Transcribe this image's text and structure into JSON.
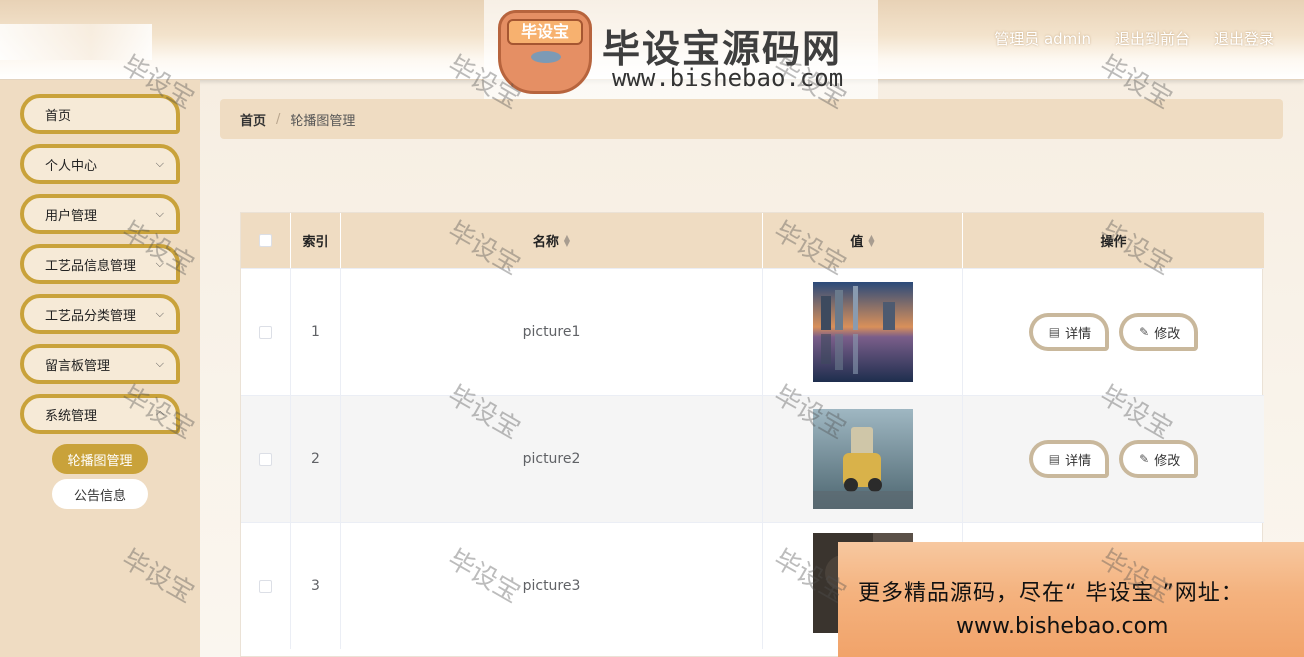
{
  "header": {
    "user_label": "管理员 admin",
    "to_front_label": "退出到前台",
    "logout_label": "退出登录"
  },
  "brand": {
    "logo_text": "毕设宝",
    "title": "毕设宝源码网",
    "url": "www.bishebao.com"
  },
  "sidebar": {
    "items": [
      {
        "label": "首页",
        "has_children": false
      },
      {
        "label": "个人中心",
        "has_children": true
      },
      {
        "label": "用户管理",
        "has_children": true
      },
      {
        "label": "工艺品信息管理",
        "has_children": true
      },
      {
        "label": "工艺品分类管理",
        "has_children": true
      },
      {
        "label": "留言板管理",
        "has_children": true
      },
      {
        "label": "系统管理",
        "has_children": true
      }
    ],
    "sub_items": [
      {
        "label": "轮播图管理",
        "active": true
      },
      {
        "label": "公告信息",
        "active": false
      }
    ]
  },
  "breadcrumb": {
    "home": "首页",
    "separator": "/",
    "current": "轮播图管理"
  },
  "table": {
    "columns": [
      "索引",
      "名称",
      "值",
      "操作"
    ],
    "rows": [
      {
        "index": "1",
        "name": "picture1"
      },
      {
        "index": "2",
        "name": "picture2"
      },
      {
        "index": "3",
        "name": "picture3"
      }
    ],
    "detail_label": "详情",
    "edit_label": "修改"
  },
  "ad": {
    "line1": "更多精品源码，尽在“ 毕设宝 ”网址：",
    "line2": "www.bishebao.com"
  },
  "watermark": "毕设宝",
  "colors": {
    "accent": "#c9a23a",
    "sidebar_bg": "#efdcc2",
    "header_bg": "#efdcc2"
  }
}
